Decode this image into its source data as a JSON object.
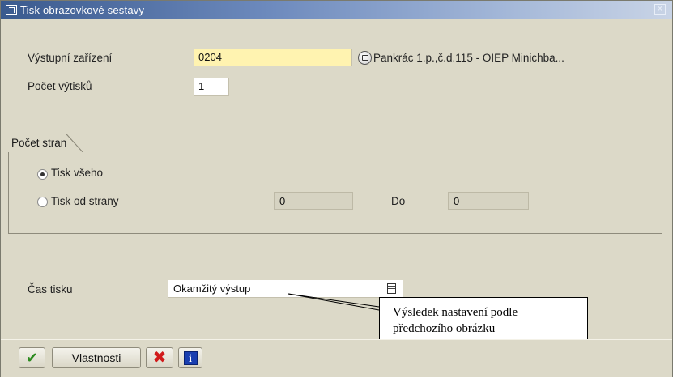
{
  "window": {
    "title": "Tisk obrazovkové sestavy",
    "close_symbol": "✕"
  },
  "output_device": {
    "label": "Výstupní zařízení",
    "value": "0204",
    "description": "Pankrác 1.p.,č.d.115 - OIEP Minichba..."
  },
  "copies": {
    "label": "Počet výtisků",
    "value": "1"
  },
  "page_range": {
    "group_title": "Počet stran",
    "print_all_label": "Tisk všeho",
    "print_all_selected": true,
    "print_from_label": "Tisk od strany",
    "print_from_selected": false,
    "from_value": "0",
    "to_label": "Do",
    "to_value": "0"
  },
  "print_time": {
    "label": "Čas tisku",
    "value": "Okamžitý výstup"
  },
  "callout": {
    "line1": "Výsledek nastavení podle",
    "line2": "předchozího obrázku"
  },
  "toolbar": {
    "confirm_icon": "check-icon",
    "properties_label": "Vlastnosti",
    "cancel_icon": "cancel-icon",
    "info_icon": "info-icon",
    "info_symbol": "i",
    "check_symbol": "✔",
    "cancel_symbol": "✖"
  },
  "colors": {
    "required_field": "#fff3b0",
    "dialog_background": "#dcd9c8",
    "titlebar": "#3a5a8e"
  }
}
